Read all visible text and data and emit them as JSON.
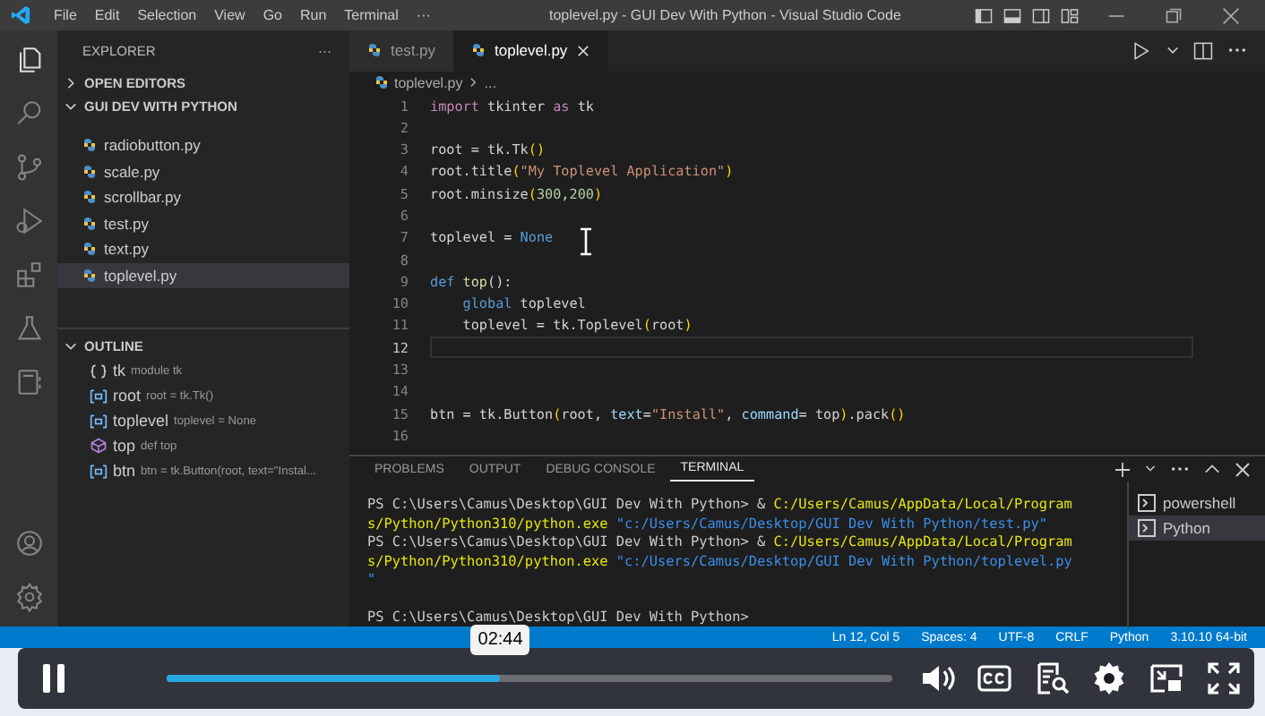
{
  "title_bar": {
    "menu": [
      "File",
      "Edit",
      "Selection",
      "View",
      "Go",
      "Run",
      "Terminal",
      "···"
    ],
    "title": "toplevel.py - GUI Dev With Python - Visual Studio Code"
  },
  "explorer": {
    "title": "EXPLORER",
    "more": "···",
    "sections": [
      {
        "label": "OPEN EDITORS",
        "expanded": false
      },
      {
        "label": "GUI DEV WITH PYTHON",
        "expanded": true,
        "files": [
          {
            "name": "radiobutton.py",
            "selected": false
          },
          {
            "name": "scale.py",
            "selected": false
          },
          {
            "name": "scrollbar.py",
            "selected": false
          },
          {
            "name": "test.py",
            "selected": false
          },
          {
            "name": "text.py",
            "selected": false
          },
          {
            "name": "toplevel.py",
            "selected": true
          }
        ]
      }
    ]
  },
  "outline": {
    "label": "OUTLINE",
    "expanded": true,
    "items": [
      {
        "kind": "module",
        "name": "tk",
        "detail": "module tk"
      },
      {
        "kind": "variable",
        "name": "root",
        "detail": "root = tk.Tk()"
      },
      {
        "kind": "variable",
        "name": "toplevel",
        "detail": "toplevel = None"
      },
      {
        "kind": "function",
        "name": "top",
        "detail": "def top"
      },
      {
        "kind": "variable",
        "name": "btn",
        "detail": "btn = tk.Button(root, text=\"Instal..."
      }
    ]
  },
  "editor": {
    "tabs": [
      {
        "label": "test.py",
        "selected": false
      },
      {
        "label": "toplevel.py",
        "selected": true
      }
    ],
    "breadcrumb": [
      "toplevel.py",
      "..."
    ],
    "lines": [
      {
        "number": "1",
        "current": false,
        "tokens": [
          {
            "text": "import",
            "kind": "control"
          },
          {
            "text": " tkinter ",
            "kind": "plain"
          },
          {
            "text": "as",
            "kind": "control"
          },
          {
            "text": " tk",
            "kind": "plain"
          }
        ]
      },
      {
        "number": "2",
        "current": false
      },
      {
        "number": "3",
        "current": false,
        "tokens": [
          {
            "text": "root = tk.Tk",
            "kind": "plain"
          },
          {
            "text": "()",
            "kind": "bracket"
          }
        ]
      },
      {
        "number": "4",
        "current": false,
        "tokens": [
          {
            "text": "root.title",
            "kind": "plain"
          },
          {
            "text": "(",
            "kind": "bracket"
          },
          {
            "text": "\"My Toplevel Application\"",
            "kind": "string"
          },
          {
            "text": ")",
            "kind": "bracket"
          }
        ]
      },
      {
        "number": "5",
        "current": false,
        "tokens": [
          {
            "text": "root.minsize",
            "kind": "plain"
          },
          {
            "text": "(",
            "kind": "bracket"
          },
          {
            "text": "300",
            "kind": "number"
          },
          {
            "text": ",",
            "kind": "plain"
          },
          {
            "text": "200",
            "kind": "number"
          },
          {
            "text": ")",
            "kind": "bracket"
          }
        ]
      },
      {
        "number": "6",
        "current": false
      },
      {
        "number": "7",
        "current": false,
        "tokens": [
          {
            "text": "toplevel = ",
            "kind": "plain"
          },
          {
            "text": "None",
            "kind": "keyword"
          }
        ]
      },
      {
        "number": "8",
        "current": false
      },
      {
        "number": "9",
        "current": false,
        "tokens": [
          {
            "text": "def",
            "kind": "keyword"
          },
          {
            "text": " top",
            "kind": "function"
          },
          {
            "text": "():",
            "kind": "plain"
          }
        ]
      },
      {
        "number": "10",
        "current": false,
        "tokens": [
          {
            "text": "    global",
            "kind": "keyword"
          },
          {
            "text": " toplevel",
            "kind": "plain"
          }
        ]
      },
      {
        "number": "11",
        "current": false,
        "tokens": [
          {
            "text": "    toplevel = tk.Toplevel",
            "kind": "plain"
          },
          {
            "text": "(",
            "kind": "bracket"
          },
          {
            "text": "root",
            "kind": "plain"
          },
          {
            "text": ")",
            "kind": "bracket"
          }
        ]
      },
      {
        "number": "12",
        "current": true
      },
      {
        "number": "13",
        "current": false
      },
      {
        "number": "14",
        "current": false
      },
      {
        "number": "15",
        "current": false,
        "tokens": [
          {
            "text": "btn = tk.Button",
            "kind": "plain"
          },
          {
            "text": "(",
            "kind": "bracket"
          },
          {
            "text": "root, ",
            "kind": "plain"
          },
          {
            "text": "text",
            "kind": "param"
          },
          {
            "text": "=",
            "kind": "plain"
          },
          {
            "text": "\"Install\"",
            "kind": "string"
          },
          {
            "text": ", ",
            "kind": "plain"
          },
          {
            "text": "command",
            "kind": "param"
          },
          {
            "text": "= top",
            "kind": "plain"
          },
          {
            "text": ")",
            "kind": "bracket"
          },
          {
            "text": ".pack",
            "kind": "plain"
          },
          {
            "text": "()",
            "kind": "bracket"
          }
        ]
      },
      {
        "number": "16",
        "current": false
      }
    ]
  },
  "panel": {
    "tabs": [
      {
        "label": "PROBLEMS",
        "selected": false
      },
      {
        "label": "OUTPUT",
        "selected": false
      },
      {
        "label": "DEBUG CONSOLE",
        "selected": false
      },
      {
        "label": "TERMINAL",
        "selected": true
      }
    ],
    "terminal_lines": [
      {
        "segments": [
          {
            "text": "PS C:\\Users\\Camus\\Desktop\\GUI Dev With Python> & ",
            "kind": "plain"
          },
          {
            "text": "C:/Users/Camus/AppData/Local/Program",
            "kind": "path"
          }
        ]
      },
      {
        "segments": [
          {
            "text": "s/Python/Python310/python.exe",
            "kind": "path"
          },
          {
            "text": " \"c:/Users/Camus/Desktop/GUI Dev With Python/test.py\"",
            "kind": "string"
          }
        ]
      },
      {
        "segments": [
          {
            "text": "PS C:\\Users\\Camus\\Desktop\\GUI Dev With Python> & ",
            "kind": "plain"
          },
          {
            "text": "C:/Users/Camus/AppData/Local/Program",
            "kind": "path"
          }
        ]
      },
      {
        "segments": [
          {
            "text": "s/Python/Python310/python.exe",
            "kind": "path"
          },
          {
            "text": " \"c:/Users/Camus/Desktop/GUI Dev With Python/toplevel.py",
            "kind": "string"
          }
        ]
      },
      {
        "segments": [
          {
            "text": "\"",
            "kind": "string"
          }
        ]
      },
      {
        "segments": [
          {
            "text": "PS C:\\Users\\Camus\\Desktop\\GUI Dev With Python>",
            "kind": "plain"
          }
        ]
      }
    ],
    "terminals": [
      {
        "label": "powershell",
        "selected": false
      },
      {
        "label": "Python",
        "selected": true
      }
    ]
  },
  "status_bar": {
    "items": [
      "Ln 12, Col 5",
      "Spaces: 4",
      "UTF-8",
      "CRLF",
      "Python",
      "3.10.10 64-bit"
    ]
  },
  "video_player": {
    "playing": true,
    "progress": {
      "level": 0.46
    },
    "time_tooltip": "02:44"
  }
}
